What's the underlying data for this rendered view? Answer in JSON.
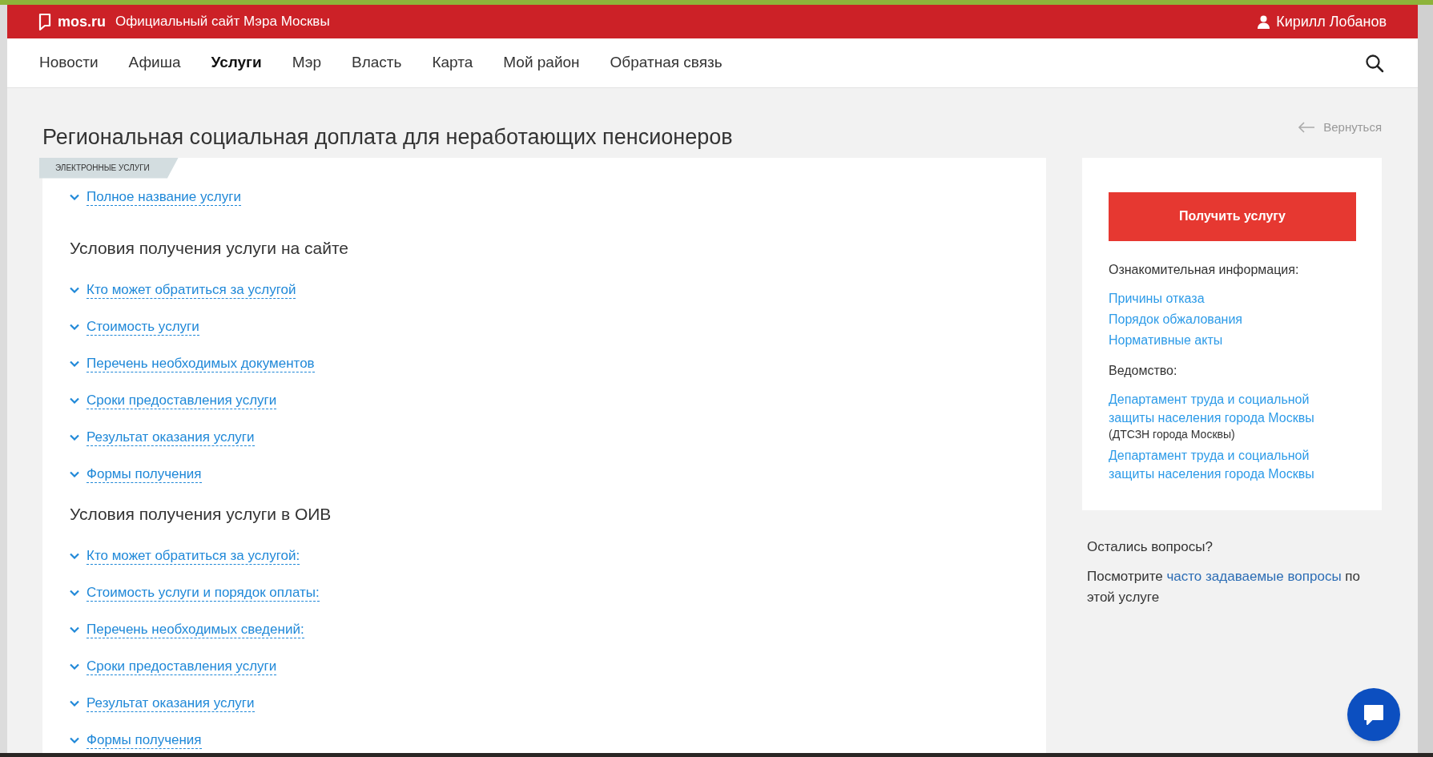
{
  "header": {
    "logo": "mos.ru",
    "site_title": "Официальный сайт Мэра Москвы",
    "user": "Кирилл Лобанов"
  },
  "nav": [
    {
      "label": "Новости",
      "selected": false
    },
    {
      "label": "Афиша",
      "selected": false
    },
    {
      "label": "Услуги",
      "selected": true
    },
    {
      "label": "Мэр",
      "selected": false
    },
    {
      "label": "Власть",
      "selected": false
    },
    {
      "label": "Карта",
      "selected": false
    },
    {
      "label": "Мой район",
      "selected": false
    },
    {
      "label": "Обратная связь",
      "selected": false
    }
  ],
  "page": {
    "title": "Региональная социальная доплата для неработающих пенсионеров",
    "back_link": "Вернуться"
  },
  "badge": "ЭЛЕКТРОННЫЕ УСЛУГИ",
  "sections": [
    {
      "items": [
        "Полное название услуги"
      ]
    },
    {
      "heading": "Условия получения услуги на сайте",
      "items": [
        "Кто может обратиться за услугой",
        "Стоимость услуги",
        "Перечень необходимых документов",
        "Сроки предоставления услуги",
        "Результат оказания услуги",
        "Формы получения"
      ]
    },
    {
      "heading": "Условия получения услуги в ОИВ",
      "items": [
        "Кто может обратиться за услугой:",
        "Стоимость услуги и порядок оплаты:",
        "Перечень необходимых сведений:",
        "Сроки предоставления услуги",
        "Результат оказания услуги",
        "Формы получения"
      ]
    }
  ],
  "sidebar": {
    "button": "Получить услугу",
    "info_label": "Ознакомительная информация:",
    "info_links": [
      "Причины отказа",
      "Порядок обжалования",
      "Нормативные акты"
    ],
    "agency_label": "Ведомство:",
    "agencies": [
      {
        "name": "Департамент труда и социальной защиты населения города Москвы",
        "abbreviation": "(ДТСЗН города Москвы)"
      },
      {
        "name": "Департамент труда и социальной защиты населения города Москвы"
      }
    ]
  },
  "questions": {
    "title": "Остались вопросы?",
    "prefix": "Посмотрите",
    "link": "часто задаваемые вопросы",
    "suffix": "по этой услуге"
  }
}
